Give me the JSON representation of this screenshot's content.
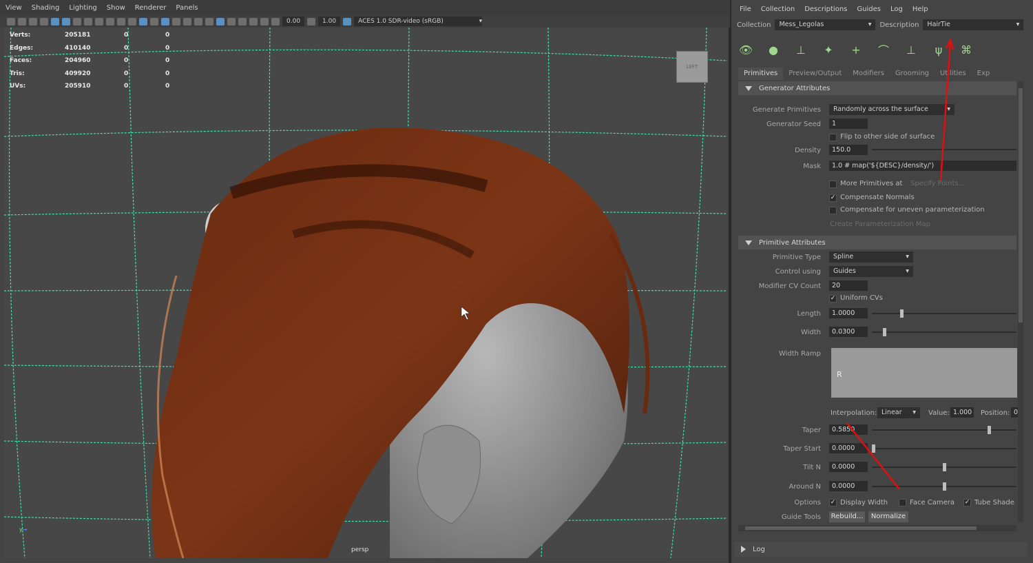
{
  "viewport": {
    "menu": [
      "View",
      "Shading",
      "Lighting",
      "Show",
      "Renderer",
      "Panels"
    ],
    "exposure": "0.00",
    "gamma": "1.00",
    "color_space": "ACES 1.0 SDR-video (sRGB)",
    "hud": [
      {
        "label": "Verts:",
        "a": "205181",
        "b": "0",
        "c": "0"
      },
      {
        "label": "Edges:",
        "a": "410140",
        "b": "0",
        "c": "0"
      },
      {
        "label": "Faces:",
        "a": "204960",
        "b": "0",
        "c": "0"
      },
      {
        "label": "Tris:",
        "a": "409920",
        "b": "0",
        "c": "0"
      },
      {
        "label": "UVs:",
        "a": "205910",
        "b": "0",
        "c": "0"
      }
    ],
    "viewcube": "LEFT",
    "camera": "persp"
  },
  "panel": {
    "menu": [
      "File",
      "Collection",
      "Descriptions",
      "Guides",
      "Log",
      "Help"
    ],
    "collection_label": "Collection",
    "collection_value": "Mess_Legolas",
    "description_label": "Description",
    "description_value": "HairTie",
    "tabs": [
      "Primitives",
      "Preview/Output",
      "Modifiers",
      "Grooming",
      "Utilities",
      "Exp"
    ],
    "gen_section": "Generator Attributes",
    "gen": {
      "generate_label": "Generate Primitives",
      "generate_value": "Randomly across the surface",
      "seed_label": "Generator Seed",
      "seed_value": "1",
      "flip_label": "Flip to other side of surface",
      "density_label": "Density",
      "density_value": "150.0",
      "mask_label": "Mask",
      "mask_value": "1.0 # map('${DESC}/density/')",
      "more_label": "More Primitives at",
      "specify": "Specify Points...",
      "comp_normals": "Compensate Normals",
      "comp_uneven": "Compensate for uneven parameterization",
      "create_map": "Create Parameterization Map"
    },
    "prim_section": "Primitive Attributes",
    "prim": {
      "type_label": "Primitive Type",
      "type_value": "Spline",
      "control_label": "Control using",
      "control_value": "Guides",
      "cv_label": "Modifier CV Count",
      "cv_value": "20",
      "uniform_label": "Uniform CVs",
      "length_label": "Length",
      "length_value": "1.0000",
      "width_label": "Width",
      "width_value": "0.0300",
      "ramp_label": "Width Ramp",
      "ramp_letter": "R",
      "interp_label": "Interpolation:",
      "interp_value": "Linear",
      "value_label": "Value:",
      "value_value": "1.000",
      "pos_label": "Position:",
      "pos_value": "0",
      "taper_label": "Taper",
      "taper_value": "0.5850",
      "taper_start_label": "Taper Start",
      "taper_start_value": "0.0000",
      "tilt_label": "Tilt N",
      "tilt_value": "0.0000",
      "around_label": "Around N",
      "around_value": "0.0000",
      "options_label": "Options",
      "display_width": "Display Width",
      "face_camera": "Face Camera",
      "tube_shade": "Tube Shade",
      "guide_tools_label": "Guide Tools",
      "rebuild": "Rebuild...",
      "normalize": "Normalize"
    },
    "log": "Log"
  },
  "sliders": {
    "length": 0.2,
    "width": 0.08,
    "taper": 0.82,
    "taper_start": 0.0,
    "tilt": 0.5,
    "around": 0.5
  }
}
